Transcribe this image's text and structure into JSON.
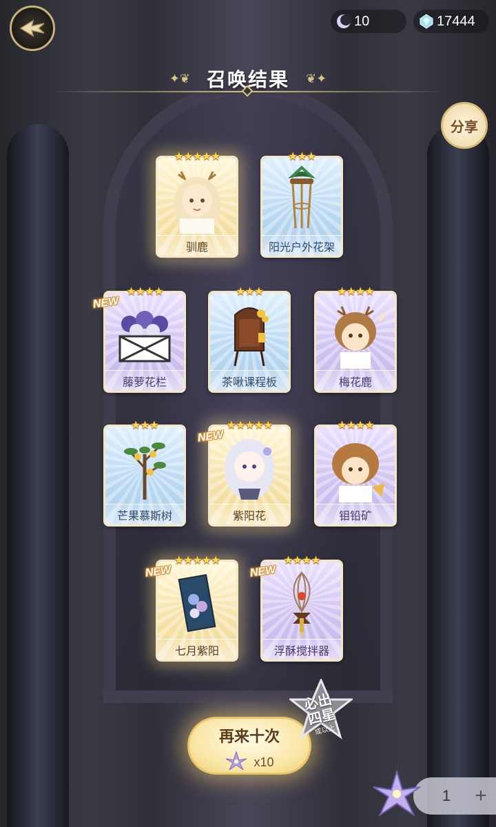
{
  "header": {
    "moon_count": "10",
    "gem_count": "17444",
    "title": "召唤结果",
    "share_label": "分享"
  },
  "cards": [
    {
      "name": "驯鹿",
      "stars": "★★★★★",
      "rarity": 5,
      "new": false,
      "icon": "deer-girl-character"
    },
    {
      "name": "阳光户外花架",
      "stars": "★★★",
      "rarity": 3,
      "new": false,
      "icon": "plant-stand"
    },
    {
      "name": "藤萝花栏",
      "stars": "★★★★",
      "rarity": 4,
      "new": true,
      "icon": "wisteria-fence"
    },
    {
      "name": "茶啾课程板",
      "stars": "★★★",
      "rarity": 3,
      "new": false,
      "icon": "course-board"
    },
    {
      "name": "梅花鹿",
      "stars": "★★★★",
      "rarity": 4,
      "new": false,
      "icon": "sika-deer-character"
    },
    {
      "name": "芒果慕斯树",
      "stars": "★★★",
      "rarity": 3,
      "new": false,
      "icon": "mango-tree"
    },
    {
      "name": "紫阳花",
      "stars": "★★★★★",
      "rarity": 5,
      "new": true,
      "icon": "hydrangea-girl-character"
    },
    {
      "name": "钼铅矿",
      "stars": "★★★★",
      "rarity": 4,
      "new": false,
      "icon": "wulfenite-character"
    },
    {
      "name": "七月紫阳",
      "stars": "★★★★★",
      "rarity": 5,
      "new": true,
      "icon": "hydrangea-painting"
    },
    {
      "name": "浮酥搅拌器",
      "stars": "★★★★",
      "rarity": 4,
      "new": true,
      "icon": "whisk"
    }
  ],
  "new_tag": "NEW",
  "again_button": {
    "label": "再来十次",
    "cost": "x10"
  },
  "guarantee_badge": {
    "line1": "必出",
    "line2": "四星",
    "line3": "或以上"
  },
  "counter": {
    "value": "1",
    "plus": "+"
  }
}
